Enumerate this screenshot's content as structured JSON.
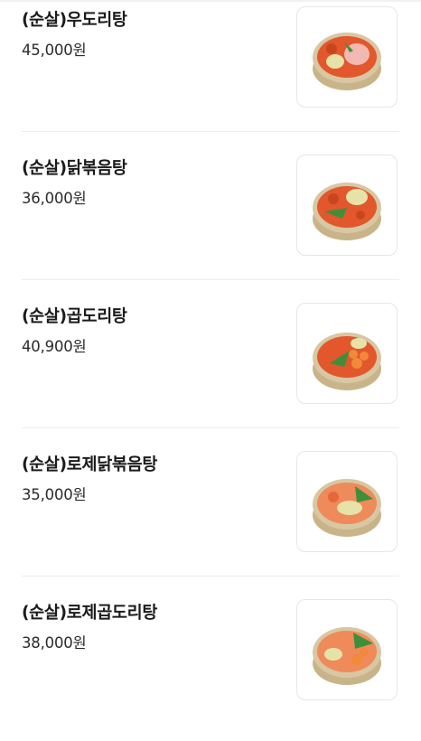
{
  "menu": {
    "items": [
      {
        "name": "(순살)우도리탕",
        "price": "45,000원",
        "image_icon": "dish-photo-icon"
      },
      {
        "name": "(순살)닭볶음탕",
        "price": "36,000원",
        "image_icon": "dish-photo-icon"
      },
      {
        "name": "(순살)곱도리탕",
        "price": "40,900원",
        "image_icon": "dish-photo-icon"
      },
      {
        "name": "(순살)로제닭볶음탕",
        "price": "35,000원",
        "image_icon": "dish-photo-icon"
      },
      {
        "name": "(순살)로제곱도리탕",
        "price": "38,000원",
        "image_icon": "dish-photo-icon"
      }
    ]
  },
  "colors": {
    "pot_rim": "#d8c7a3",
    "pot_body": "#c9b48a",
    "sauce": "#e2572c",
    "rose_sauce": "#ef8a5a",
    "greens": "#3f8f3a",
    "cabbage": "#e7e3a8",
    "meat": "#f2b9b3"
  }
}
